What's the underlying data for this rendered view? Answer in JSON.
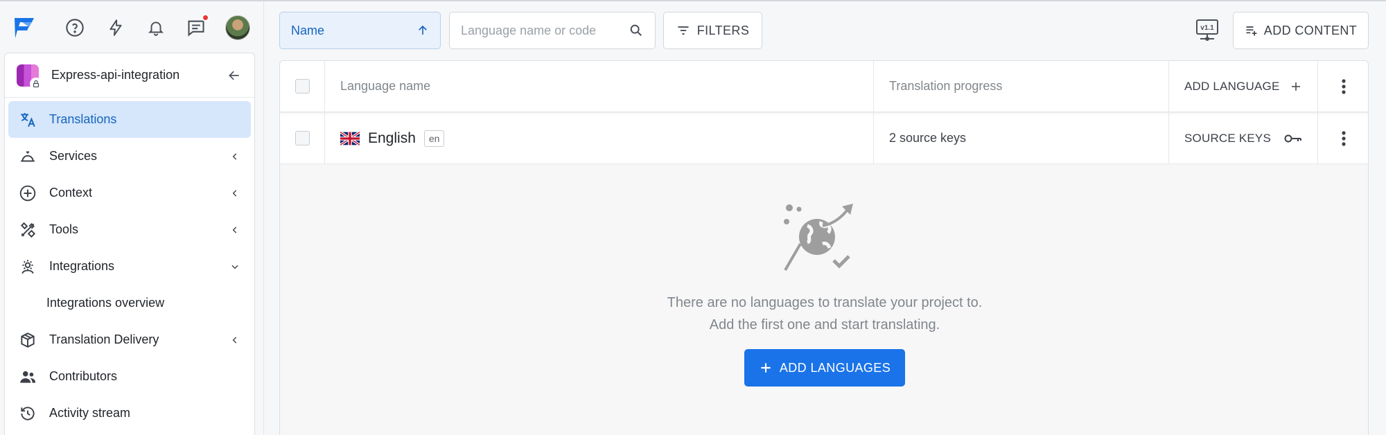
{
  "topbar": {
    "help_icon": "help-circle-icon",
    "lightning_icon": "lightning-icon",
    "bell_icon": "bell-icon",
    "chat_icon": "chat-icon",
    "notification_dot_color": "#e53935"
  },
  "project": {
    "name": "Express-api-integration"
  },
  "sidebar": {
    "items": [
      {
        "label": "Translations",
        "icon": "translate-icon",
        "active": true
      },
      {
        "label": "Services",
        "icon": "services-bell-icon"
      },
      {
        "label": "Context",
        "icon": "plus-circle-icon"
      },
      {
        "label": "Tools",
        "icon": "tools-icon"
      },
      {
        "label": "Integrations",
        "icon": "integrations-gear-icon",
        "expanded": true
      },
      {
        "label": "Integrations overview",
        "sub": true
      },
      {
        "label": "Translation Delivery",
        "icon": "box-icon"
      },
      {
        "label": "Contributors",
        "icon": "people-icon"
      },
      {
        "label": "Activity stream",
        "icon": "history-icon"
      }
    ]
  },
  "toolbar": {
    "sort_label": "Name",
    "search_placeholder": "Language name or code",
    "filters_label": "FILTERS",
    "version_badge": "v1.1",
    "add_content_label": "ADD CONTENT"
  },
  "table": {
    "headers": {
      "name": "Language name",
      "progress": "Translation progress",
      "add_language": "ADD LANGUAGE"
    },
    "rows": [
      {
        "name": "English",
        "code": "en",
        "progress": "2 source keys",
        "action": "SOURCE KEYS"
      }
    ]
  },
  "empty_state": {
    "line1": "There are no languages to translate your project to.",
    "line2": "Add the first one and start translating.",
    "button_label": "ADD LANGUAGES"
  },
  "colors": {
    "accent": "#1a73e8",
    "active_bg": "#d6e6fb",
    "active_text": "#1565c0"
  }
}
